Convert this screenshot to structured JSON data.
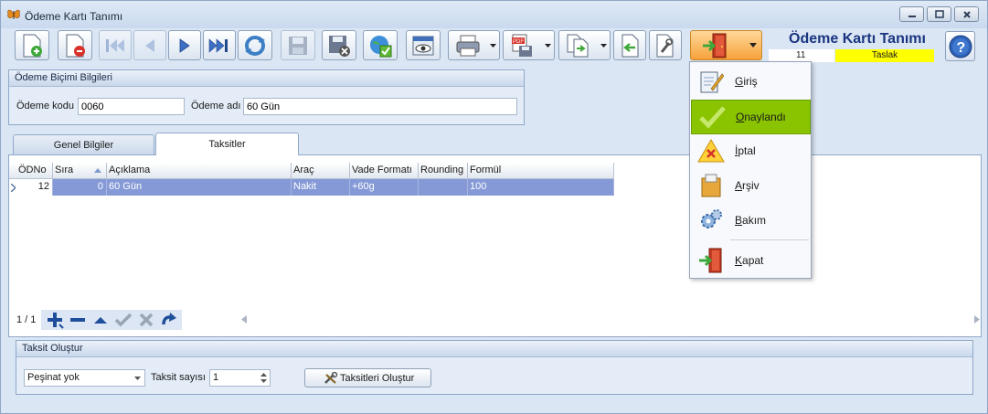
{
  "window": {
    "title": "Ödeme Kartı Tanımı"
  },
  "header": {
    "form_title": "Ödeme Kartı Tanımı",
    "doc_number": "11",
    "status": "Taslak"
  },
  "payment_info": {
    "group_title": "Ödeme Biçimi Bilgileri",
    "code_label": "Ödeme kodu",
    "code_value": "0060",
    "name_label": "Ödeme adı",
    "name_value": "60 Gün"
  },
  "tabs": [
    {
      "label": "Genel Bilgiler"
    },
    {
      "label": "Taksitler"
    }
  ],
  "grid": {
    "columns": [
      "ÖDNo",
      "Sıra",
      "Açıklama",
      "Araç",
      "Vade Formatı",
      "Rounding",
      "Formül"
    ],
    "rows": [
      {
        "odno": "12",
        "sira": "0",
        "aciklama": "60 Gün",
        "arac": "Nakit",
        "vade": "+60g",
        "rounding": "",
        "formul": "100"
      }
    ],
    "pager": "1 / 1"
  },
  "menu": {
    "items": [
      {
        "label": "Giriş"
      },
      {
        "label": "Onaylandı"
      },
      {
        "label": "İptal"
      },
      {
        "label": "Arşiv"
      },
      {
        "label": "Bakım"
      },
      {
        "label": "Kapat"
      }
    ]
  },
  "installment": {
    "group_title": "Taksit Oluştur",
    "down_payment_value": "Peşinat yok",
    "count_label": "Taksit sayısı",
    "count_value": "1",
    "create_button": "Taksitleri Oluştur"
  },
  "colors": {
    "accent": "#1a3580",
    "status_bg": "#ffff00",
    "selected_row": "#8499d6",
    "menu_selected": "#8ac400"
  }
}
